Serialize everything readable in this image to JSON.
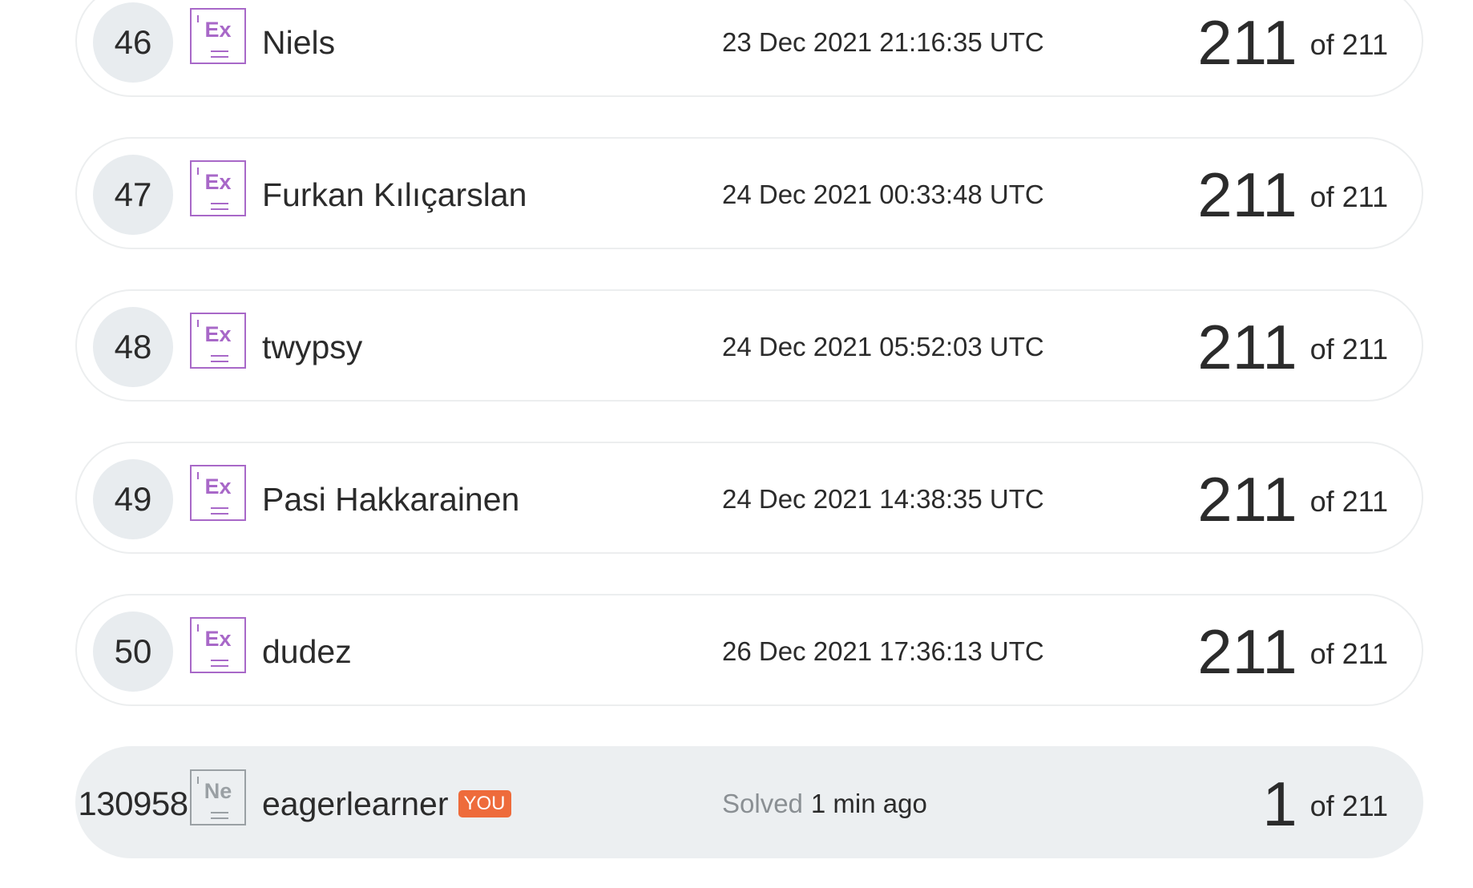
{
  "leaderboard": [
    {
      "rank": "46",
      "badge": "Ex",
      "name": "Niels",
      "time": "23 Dec 2021 21:16:35 UTC",
      "score": "211",
      "total": "of 211"
    },
    {
      "rank": "47",
      "badge": "Ex",
      "name": "Furkan Kılıçarslan",
      "time": "24 Dec 2021 00:33:48 UTC",
      "score": "211",
      "total": "of 211"
    },
    {
      "rank": "48",
      "badge": "Ex",
      "name": "twypsy",
      "time": "24 Dec 2021 05:52:03 UTC",
      "score": "211",
      "total": "of 211"
    },
    {
      "rank": "49",
      "badge": "Ex",
      "name": "Pasi Hakkarainen",
      "time": "24 Dec 2021 14:38:35 UTC",
      "score": "211",
      "total": "of 211"
    },
    {
      "rank": "50",
      "badge": "Ex",
      "name": "dudez",
      "time": "26 Dec 2021 17:36:13 UTC",
      "score": "211",
      "total": "of 211"
    }
  ],
  "current_user": {
    "rank": "130958",
    "badge": "Ne",
    "name": "eagerlearner",
    "you_label": "YOU",
    "solved_label": "Solved",
    "solved_time": "1 min ago",
    "score": "1",
    "total": "of 211"
  },
  "colors": {
    "badge_expert": "#a868c8",
    "badge_newbie": "#9aa0a4",
    "you_badge": "#ee6b3b",
    "current_row": "#eceff1"
  }
}
